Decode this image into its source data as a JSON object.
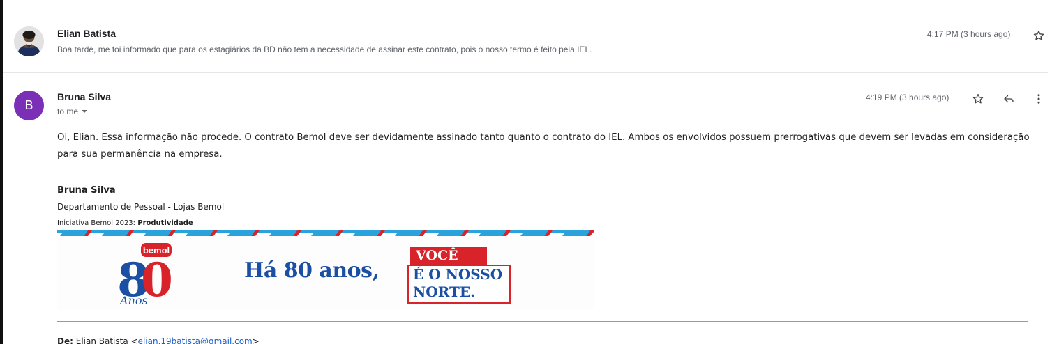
{
  "thread": {
    "messages": [
      {
        "sender": "Elian Batista",
        "time": "4:17 PM (3 hours ago)",
        "snippet": "Boa tarde, me foi informado que para os estagiários da BD não tem a necessidade de assinar este contrato, pois o nosso termo é feito pela IEL."
      },
      {
        "sender": "Bruna Silva",
        "avatar_letter": "B",
        "time": "4:19 PM (3 hours ago)",
        "recipient": "to me",
        "body": "Oi, Elian. Essa informação não procede. O contrato Bemol deve ser devidamente assinado tanto quanto o contrato do IEL. Ambos os envolvidos possuem prerrogativas que devem ser levadas em consideração para sua permanência na empresa.",
        "signature": {
          "name": "Bruna Silva",
          "department": "Departamento de Pessoal - Lojas Bemol",
          "initiative_label": "Iniciativa Bemol 2023:",
          "initiative_value": "Produtividade"
        },
        "banner": {
          "logo_brand": "bemol",
          "logo_number": "80",
          "logo_subtitle": "Anos",
          "headline": "Há 80 anos,",
          "highlight_top": "VOCÊ",
          "highlight_line1": "É O NOSSO",
          "highlight_line2": "NORTE."
        },
        "quoted": {
          "from_label": "De:",
          "from_name": "Elian Batista <",
          "from_email": "elian.19batista@gmail.com",
          "from_close": ">"
        }
      }
    ]
  },
  "colors": {
    "avatar_purple": "#7b2fb7",
    "banner_blue": "#1a4fa3",
    "banner_red": "#d8232a",
    "link_blue": "#1a5fc8"
  },
  "icons": [
    "star-icon",
    "reply-icon",
    "more-vert-icon",
    "chevron-down-icon"
  ]
}
